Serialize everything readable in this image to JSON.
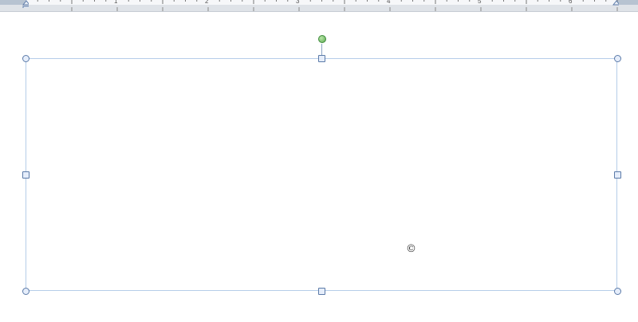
{
  "ruler": {
    "numbers": [
      "1",
      "2",
      "3",
      "4",
      "5",
      "6"
    ]
  },
  "shape": {
    "symbol": "©"
  },
  "icons": {
    "rotate": "rotate-handle-icon",
    "indent": "indent-marker-icon"
  },
  "colors": {
    "selection_border": "#b6cde9",
    "handle_border": "#5b7aa8",
    "rotate_handle": "#5caa4f"
  }
}
